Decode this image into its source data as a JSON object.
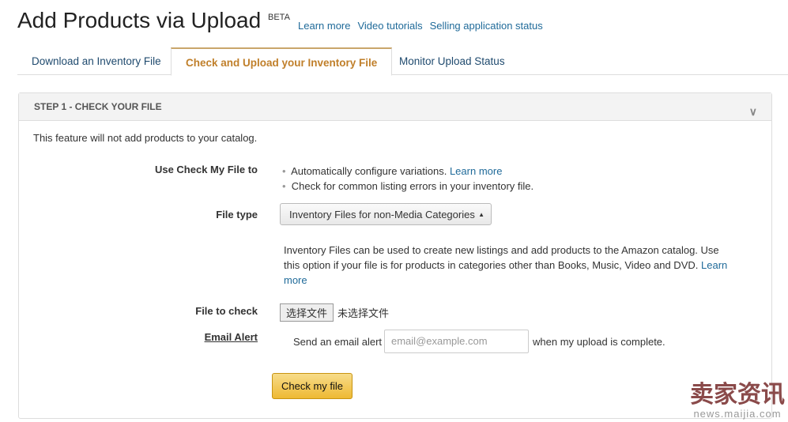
{
  "header": {
    "title": "Add Products via Upload",
    "badge": "BETA",
    "links": [
      "Learn more",
      "Video tutorials",
      "Selling application status"
    ]
  },
  "tabs": [
    "Download an Inventory File",
    "Check and Upload your Inventory File",
    "Monitor Upload Status"
  ],
  "panel": {
    "heading": "STEP 1 - CHECK YOUR FILE",
    "intro": "This feature will not add products to your catalog.",
    "use_label": "Use Check My File to",
    "bullets": [
      "Automatically configure variations.",
      "Check for common listing errors in your inventory file."
    ],
    "bullet_link": "Learn more",
    "file_type_label": "File type",
    "file_type_value": "Inventory Files for non-Media Categories",
    "description": "Inventory Files can be used to create new listings and add products to the Amazon catalog. Use this option if your file is for products in categories other than Books, Music, Video and DVD.",
    "description_link": "Learn more",
    "file_label": "File to check",
    "choose_button": "选择文件",
    "no_file": "未选择文件",
    "email_label": "Email Alert",
    "email_prefix": "Send an email alert",
    "email_placeholder": "email@example.com",
    "email_suffix": "when my upload is complete.",
    "submit": "Check my file"
  },
  "watermark": {
    "brand": "卖家资讯",
    "url": "news.maijia.com"
  }
}
